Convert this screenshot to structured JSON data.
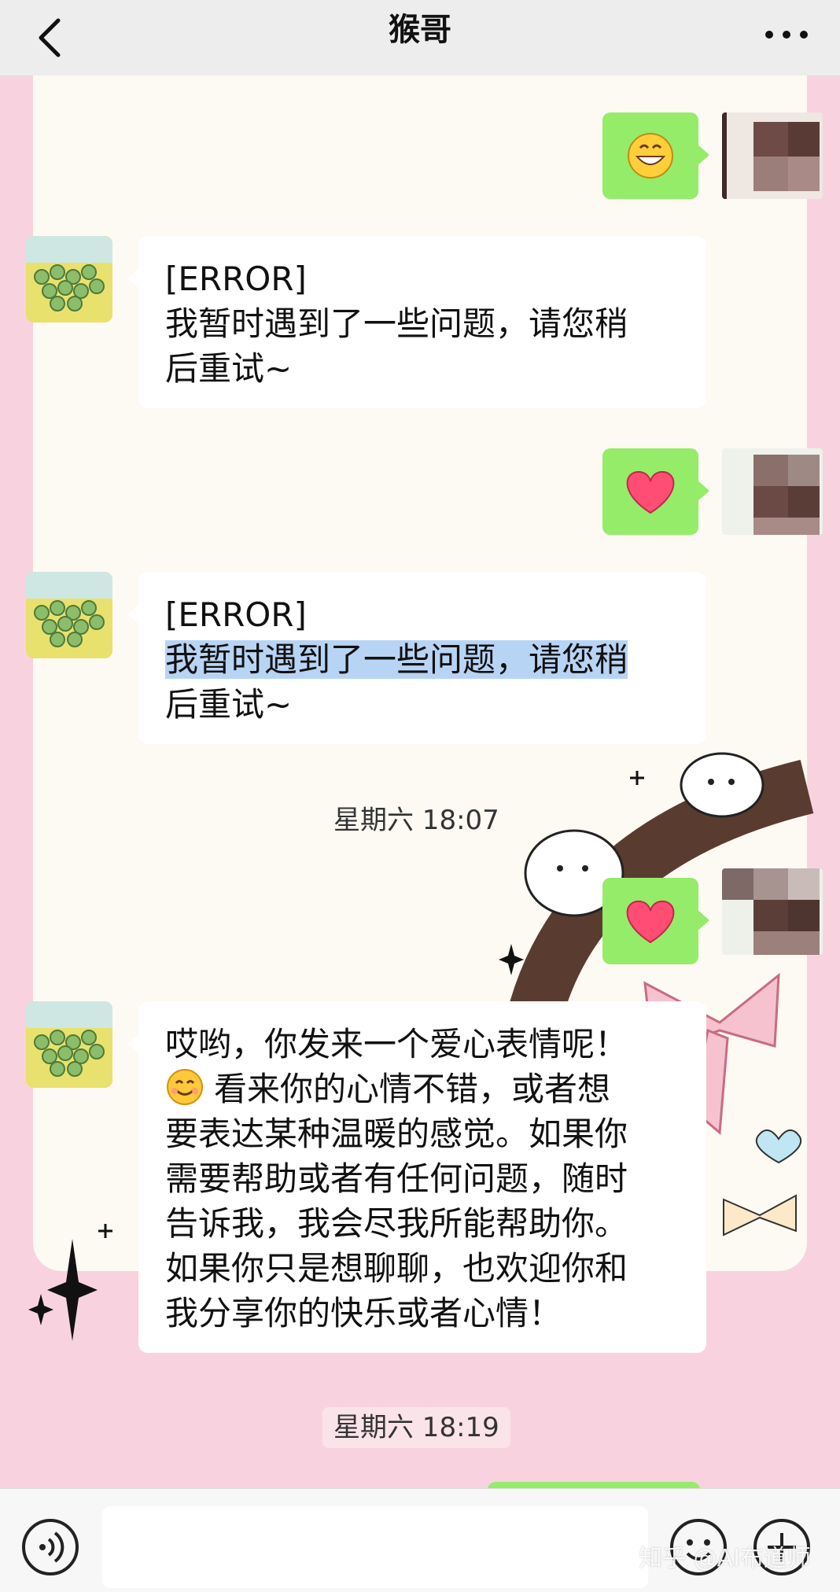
{
  "header": {
    "title": "猴哥"
  },
  "messages": [
    {
      "from": "me",
      "content": "grin-emoji-icon"
    },
    {
      "from": "bot",
      "lines": [
        "[ERROR]",
        "我暂时遇到了一些问题，请您稍",
        "后重试~"
      ]
    },
    {
      "from": "me",
      "content": "heart-emoji-icon"
    },
    {
      "from": "bot",
      "lines": [
        "[ERROR]",
        "我暂时遇到了一些问题，请您稍",
        "后重试~"
      ],
      "selected_line": 1
    },
    {
      "from": "time",
      "text": "星期六 18:07"
    },
    {
      "from": "me",
      "content": "heart-emoji-icon"
    },
    {
      "from": "bot",
      "lines": [
        "哎哟，你发来一个爱心表情呢！",
        "看来你的心情不错，或者想",
        "要表达某种温暖的感觉。如果你",
        "需要帮助或者有任何问题，随时",
        "告诉我，我会尽我所能帮助你。",
        "如果你只是想聊聊，也欢迎你和",
        "我分享你的快乐或者心情！"
      ],
      "inline_emoji": "smile-emoji-icon"
    },
    {
      "from": "time",
      "text": "星期六 18:19"
    }
  ],
  "input": {
    "placeholder": ""
  },
  "watermark": "知乎 @AI布道师",
  "colors": {
    "bubble_me": "#95ec69",
    "bubble_bot": "#ffffff",
    "background": "#f8d3df",
    "card": "#fdf9f3",
    "selection": "#b8d4f4"
  }
}
